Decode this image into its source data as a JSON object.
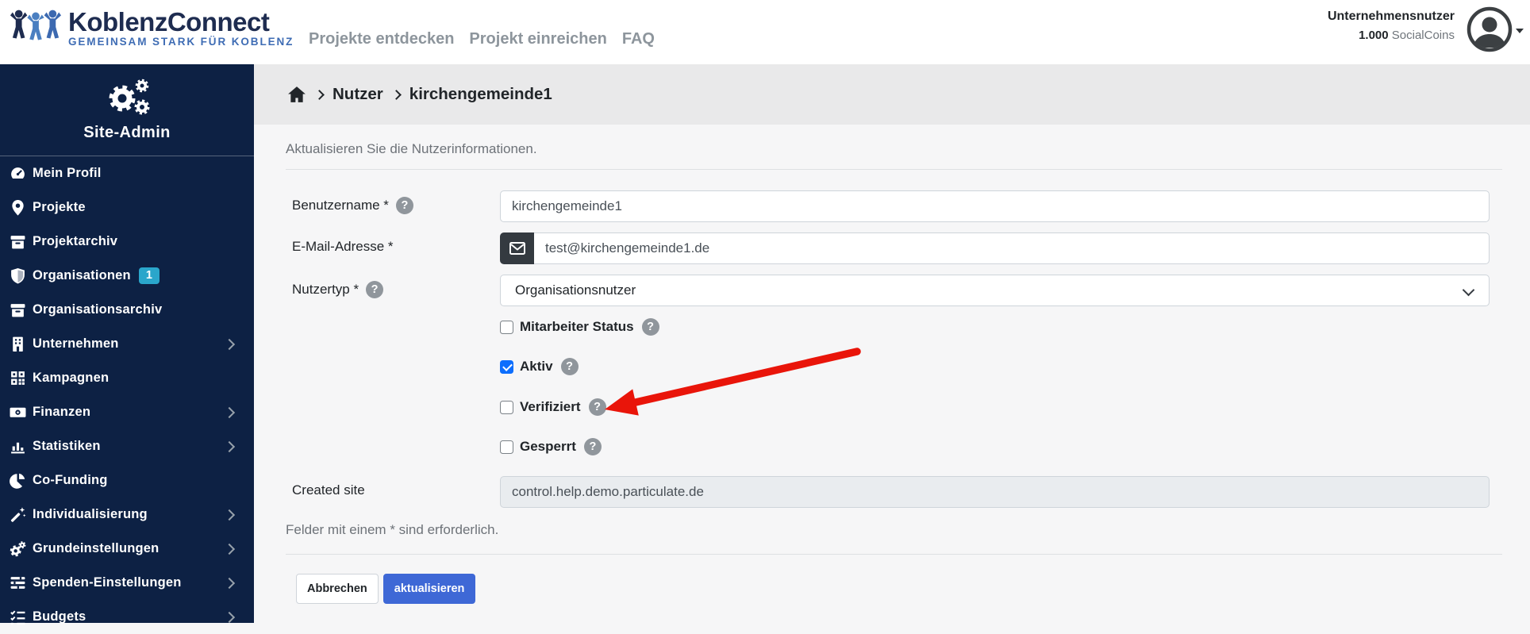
{
  "colors": {
    "sidebar_bg": "#0d2144",
    "badge_teal": "#2aa6cb",
    "primary_button_blue": "#3e68d6",
    "checkbox_checked_blue": "#0d6efd",
    "annotation_arrow_red": "#e9150a",
    "logo_dark": "#1e2c50",
    "logo_blue": "#3e6cb4",
    "breadcrumb_band": "#e9e9ea"
  },
  "header": {
    "logo": {
      "title": "KoblenzConnect",
      "tagline": "GEMEINSAM STARK FÜR KOBLENZ"
    },
    "nav": [
      {
        "label": "Projekte entdecken"
      },
      {
        "label": "Projekt einreichen"
      },
      {
        "label": "FAQ"
      }
    ],
    "user": {
      "role": "Unternehmensnutzer",
      "coins_value": "1.000",
      "coins_label": "SocialCoins"
    }
  },
  "sidebar": {
    "title": "Site-Admin",
    "items": [
      {
        "label": "Mein Profil",
        "icon": "tachometer"
      },
      {
        "label": "Projekte",
        "icon": "map-marker"
      },
      {
        "label": "Projektarchiv",
        "icon": "archive"
      },
      {
        "label": "Organisationen",
        "icon": "shield",
        "badge": "1"
      },
      {
        "label": "Organisationsarchiv",
        "icon": "archive"
      },
      {
        "label": "Unternehmen",
        "icon": "building",
        "has_submenu": true
      },
      {
        "label": "Kampagnen",
        "icon": "qr-grid"
      },
      {
        "label": "Finanzen",
        "icon": "money-bill",
        "has_submenu": true
      },
      {
        "label": "Statistiken",
        "icon": "bar-chart",
        "has_submenu": true
      },
      {
        "label": "Co-Funding",
        "icon": "pie-chart"
      },
      {
        "label": "Individualisierung",
        "icon": "magic-wand",
        "has_submenu": true
      },
      {
        "label": "Grundeinstellungen",
        "icon": "gears",
        "has_submenu": true
      },
      {
        "label": "Spenden-Einstellungen",
        "icon": "sliders",
        "has_submenu": true
      },
      {
        "label": "Budgets",
        "icon": "tasks",
        "has_submenu": true
      }
    ]
  },
  "breadcrumb": {
    "level1": "Nutzer",
    "current": "kirchengemeinde1"
  },
  "main": {
    "intro": "Aktualisieren Sie die Nutzerinformationen.",
    "form": {
      "username": {
        "label": "Benutzername *",
        "value": "kirchengemeinde1"
      },
      "email": {
        "label": "E-Mail-Adresse *",
        "value": "test@kirchengemeinde1.de"
      },
      "usertype": {
        "label": "Nutzertyp *",
        "value": "Organisationsnutzer"
      },
      "checkboxes": [
        {
          "label": "Mitarbeiter Status",
          "checked": false
        },
        {
          "label": "Aktiv",
          "checked": true
        },
        {
          "label": "Verifiziert",
          "checked": false
        },
        {
          "label": "Gesperrt",
          "checked": false
        }
      ],
      "created_site": {
        "label": "Created site",
        "value": "control.help.demo.particulate.de"
      },
      "required_note": "Felder mit einem * sind erforderlich.",
      "buttons": {
        "cancel": "Abbrechen",
        "submit": "aktualisieren"
      }
    }
  }
}
